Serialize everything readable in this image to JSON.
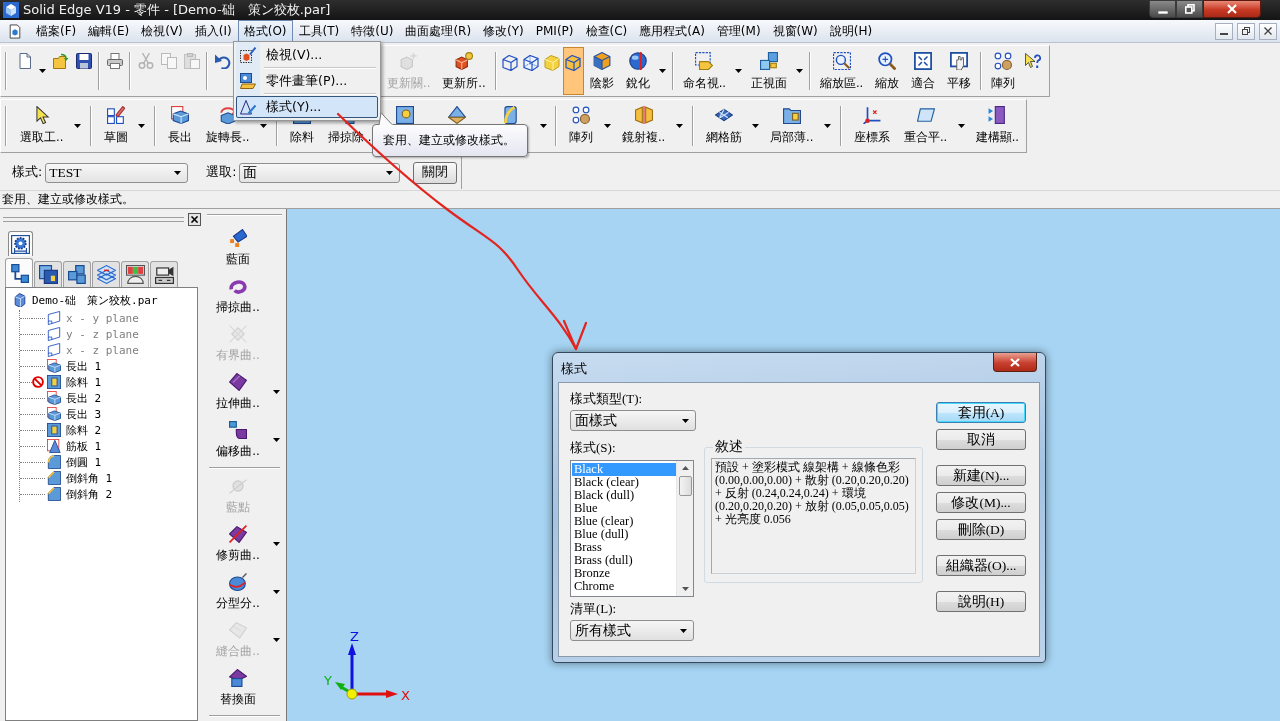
{
  "window": {
    "title": "Solid Edge V19 - 零件 - [Demo-础　策ン狡枚.par]"
  },
  "menu_bar": {
    "items": [
      {
        "label": "檔案(F)",
        "selected": false
      },
      {
        "label": "編輯(E)",
        "selected": false
      },
      {
        "label": "檢視(V)",
        "selected": false
      },
      {
        "label": "插入(I)",
        "selected": false
      },
      {
        "label": "格式(O)",
        "selected": true
      },
      {
        "label": "工具(T)",
        "selected": false
      },
      {
        "label": "特徵(U)",
        "selected": false
      },
      {
        "label": "曲面處理(R)",
        "selected": false
      },
      {
        "label": "修改(Y)",
        "selected": false
      },
      {
        "label": "PMI(P)",
        "selected": false
      },
      {
        "label": "檢查(C)",
        "selected": false
      },
      {
        "label": "應用程式(A)",
        "selected": false
      },
      {
        "label": "管理(M)",
        "selected": false
      },
      {
        "label": "視窗(W)",
        "selected": false
      },
      {
        "label": "說明(H)",
        "selected": false
      }
    ]
  },
  "toolbar_main": {
    "items": [
      {
        "kind": "icon",
        "disabled": false
      },
      {
        "kind": "dropdown"
      },
      {
        "kind": "icon",
        "disabled": false
      },
      {
        "kind": "icon",
        "disabled": false
      },
      {
        "kind": "separator"
      },
      {
        "kind": "icon",
        "disabled": false
      },
      {
        "kind": "separator"
      },
      {
        "kind": "icon",
        "disabled": true
      },
      {
        "kind": "icon",
        "disabled": true
      },
      {
        "kind": "icon",
        "disabled": true
      },
      {
        "kind": "separator"
      },
      {
        "kind": "icon",
        "disabled": false
      },
      {
        "kind": "button",
        "label": "更新關..",
        "disabled": true
      },
      {
        "kind": "button",
        "label": "更新所..",
        "disabled": false
      },
      {
        "kind": "separator"
      },
      {
        "kind": "toggle",
        "pressed": false
      },
      {
        "kind": "toggle",
        "pressed": false
      },
      {
        "kind": "toggle",
        "pressed": false
      },
      {
        "kind": "toggle",
        "pressed": true
      },
      {
        "kind": "button",
        "label": "陰影",
        "disabled": false
      },
      {
        "kind": "button",
        "label": "銳化",
        "disabled": false
      },
      {
        "kind": "dropdown"
      },
      {
        "kind": "separator"
      },
      {
        "kind": "button",
        "label": "命名視..",
        "disabled": false
      },
      {
        "kind": "dropdown"
      },
      {
        "kind": "button",
        "label": "正視面",
        "disabled": false
      },
      {
        "kind": "dropdown"
      },
      {
        "kind": "separator"
      },
      {
        "kind": "button",
        "label": "縮放區..",
        "disabled": false
      },
      {
        "kind": "button",
        "label": "縮放",
        "disabled": false
      },
      {
        "kind": "button",
        "label": "適合",
        "disabled": false
      },
      {
        "kind": "button",
        "label": "平移",
        "disabled": false
      },
      {
        "kind": "separator"
      },
      {
        "kind": "button",
        "label": "陣列",
        "disabled": false
      },
      {
        "kind": "icon",
        "disabled": false
      }
    ]
  },
  "toolbar_features": {
    "items": [
      {
        "kind": "button",
        "label": "選取工.."
      },
      {
        "kind": "dropdown"
      },
      {
        "kind": "separator"
      },
      {
        "kind": "button",
        "label": "草圖"
      },
      {
        "kind": "dropdown"
      },
      {
        "kind": "separator"
      },
      {
        "kind": "button",
        "label": "長出"
      },
      {
        "kind": "button",
        "label": "旋轉長.."
      },
      {
        "kind": "dropdown"
      },
      {
        "kind": "separator"
      },
      {
        "kind": "button",
        "label": "除料"
      },
      {
        "kind": "button",
        "label": "掃掠除.."
      },
      {
        "kind": "button"
      },
      {
        "kind": "button"
      },
      {
        "kind": "button"
      },
      {
        "kind": "dropdown"
      },
      {
        "kind": "separator"
      },
      {
        "kind": "button",
        "label": "陣列"
      },
      {
        "kind": "dropdown"
      },
      {
        "kind": "button",
        "label": "鏡射複.."
      },
      {
        "kind": "dropdown"
      },
      {
        "kind": "separator"
      },
      {
        "kind": "button",
        "label": "網格筋"
      },
      {
        "kind": "dropdown"
      },
      {
        "kind": "button",
        "label": "局部薄.."
      },
      {
        "kind": "dropdown"
      },
      {
        "kind": "separator"
      },
      {
        "kind": "button",
        "label": "座標系"
      },
      {
        "kind": "button",
        "label": "重合平.."
      },
      {
        "kind": "dropdown"
      },
      {
        "kind": "button",
        "label": "建構顯.."
      }
    ]
  },
  "style_bar": {
    "style_label": "樣式:",
    "style_value": "TEST",
    "select_label": "選取:",
    "select_value": "面",
    "close_button": "關閉"
  },
  "status_bar": {
    "text": "套用、建立或修改樣式。"
  },
  "pathfinder": {
    "top_tabs": [
      {
        "selected": true
      }
    ],
    "tabs": [
      {
        "selected": true
      },
      {
        "selected": false
      },
      {
        "selected": false
      },
      {
        "selected": false
      },
      {
        "selected": false
      },
      {
        "selected": false
      }
    ],
    "tree": {
      "label": "Demo-础　策ン狡枚.par",
      "children": [
        {
          "label": "x - y plane",
          "greyed": true,
          "error": false
        },
        {
          "label": "y - z plane",
          "greyed": true,
          "error": false
        },
        {
          "label": "x - z plane",
          "greyed": true,
          "error": false
        },
        {
          "label": "長出 1",
          "greyed": false,
          "error": false
        },
        {
          "label": "除料 1",
          "greyed": false,
          "error": true
        },
        {
          "label": "長出 2",
          "greyed": false,
          "error": false
        },
        {
          "label": "長出 3",
          "greyed": false,
          "error": false
        },
        {
          "label": "除料 2",
          "greyed": false,
          "error": false
        },
        {
          "label": "筋板 1",
          "greyed": false,
          "error": false
        },
        {
          "label": "倒圓 1",
          "greyed": false,
          "error": false
        },
        {
          "label": "倒斜角 1",
          "greyed": false,
          "error": false
        },
        {
          "label": "倒斜角 2",
          "greyed": false,
          "error": false
        }
      ]
    }
  },
  "surface_toolbar": {
    "items": [
      {
        "kind": "button",
        "label": "藍面",
        "disabled": false,
        "dropdown": false
      },
      {
        "kind": "button",
        "label": "掃掠曲..",
        "disabled": false,
        "dropdown": false
      },
      {
        "kind": "button",
        "label": "有界曲..",
        "disabled": true,
        "dropdown": false
      },
      {
        "kind": "button",
        "label": "拉伸曲..",
        "disabled": false,
        "dropdown": true
      },
      {
        "kind": "button",
        "label": "偏移曲..",
        "disabled": false,
        "dropdown": true
      },
      {
        "kind": "separator"
      },
      {
        "kind": "button",
        "label": "藍點",
        "disabled": true,
        "dropdown": false
      },
      {
        "kind": "button",
        "label": "修剪曲..",
        "disabled": false,
        "dropdown": true
      },
      {
        "kind": "button",
        "label": "分型分..",
        "disabled": false,
        "dropdown": true
      },
      {
        "kind": "button",
        "label": "縫合曲..",
        "disabled": true,
        "dropdown": true
      },
      {
        "kind": "button",
        "label": "替換面",
        "disabled": false,
        "dropdown": false
      },
      {
        "kind": "separator"
      }
    ]
  },
  "viewport": {
    "triad": {
      "z": "Z",
      "y": "Y",
      "x": "X"
    }
  },
  "format_menu": {
    "items": [
      {
        "label": "檢視(V)...",
        "selected": false
      },
      {
        "label": "零件畫筆(P)...",
        "selected": false
      },
      {
        "label": "樣式(Y)...",
        "selected": true
      }
    ]
  },
  "tooltip": {
    "text": "套用、建立或修改樣式。"
  },
  "style_dialog": {
    "title": "樣式",
    "type_label": "樣式類型(T):",
    "type_value": "面樣式",
    "styles_label": "樣式(S):",
    "styles": [
      {
        "label": "Black",
        "selected": true
      },
      {
        "label": "Black (clear)",
        "selected": false
      },
      {
        "label": "Black (dull)",
        "selected": false
      },
      {
        "label": "Blue",
        "selected": false
      },
      {
        "label": "Blue (clear)",
        "selected": false
      },
      {
        "label": "Blue (dull)",
        "selected": false
      },
      {
        "label": "Brass",
        "selected": false
      },
      {
        "label": "Brass (dull)",
        "selected": false
      },
      {
        "label": "Bronze",
        "selected": false
      },
      {
        "label": "Chrome",
        "selected": false
      }
    ],
    "list_label": "清單(L):",
    "list_value": "所有樣式",
    "description_title": "敘述",
    "description": "預設 + 塗彩模式 線架構 + 線條色彩 (0.00,0.00,0.00) + 散射 (0.20,0.20,0.20) + 反射 (0.24,0.24,0.24) + 環境 (0.20,0.20,0.20) + 放射 (0.05,0.05,0.05) + 光亮度 0.056",
    "button_groups": [
      [
        {
          "label": "套用(A)",
          "default": true
        },
        {
          "label": "取消",
          "default": false
        }
      ],
      [
        {
          "label": "新建(N)...",
          "default": false
        },
        {
          "label": "修改(M)...",
          "default": false
        },
        {
          "label": "刪除(D)",
          "default": false
        }
      ],
      [
        {
          "label": "組織器(O)...",
          "default": false
        }
      ],
      [
        {
          "label": "說明(H)",
          "default": false
        }
      ]
    ]
  }
}
